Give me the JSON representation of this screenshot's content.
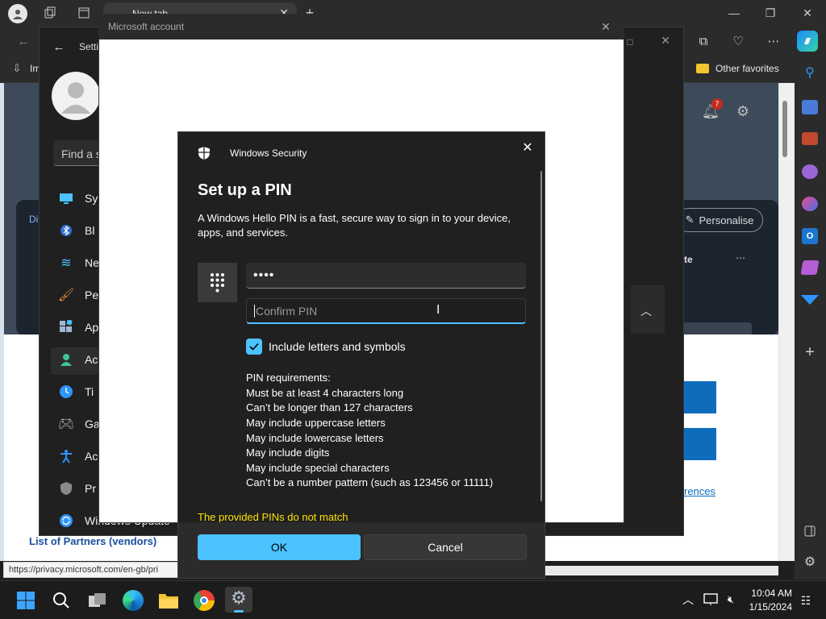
{
  "browser": {
    "tab_title": "New tab",
    "favorites": {
      "left_item": "Im",
      "other_favorites": "Other favorites"
    },
    "status_url": "https://privacy.microsoft.com/en-gb/pri",
    "notification_count": "7",
    "personalise": "Personalise",
    "card_fragment": "te",
    "lower_link": "rences",
    "partners_link": "List of Partners (vendors)",
    "tab_fragment": "Di"
  },
  "settings": {
    "title": "Setti",
    "search_placeholder": "Find a s",
    "nav": [
      {
        "label": "Sy",
        "icon": "system-icon"
      },
      {
        "label": "Bl",
        "icon": "bluetooth-icon"
      },
      {
        "label": "Ne",
        "icon": "network-icon"
      },
      {
        "label": "Pe",
        "icon": "personalisation-icon"
      },
      {
        "label": "Ap",
        "icon": "apps-icon"
      },
      {
        "label": "Ac",
        "icon": "accounts-icon"
      },
      {
        "label": "Ti",
        "icon": "time-icon"
      },
      {
        "label": "Ga",
        "icon": "gaming-icon"
      },
      {
        "label": "Ac",
        "icon": "accessibility-icon"
      },
      {
        "label": "Pr",
        "icon": "privacy-icon"
      },
      {
        "label": "Windows Update",
        "icon": "update-icon"
      }
    ]
  },
  "ms_account": {
    "title": "Microsoft account"
  },
  "winsec": {
    "app_title": "Windows Security",
    "heading": "Set up a PIN",
    "description": "A Windows Hello PIN is a fast, secure way to sign in to your device, apps, and services.",
    "pin_value": "••••",
    "confirm_placeholder": "Confirm PIN",
    "checkbox_label": "Include letters and symbols",
    "requirements_title": "PIN requirements:",
    "requirements": [
      "Must be at least 4 characters long",
      "Can’t be longer than 127 characters",
      "May include uppercase letters",
      "May include lowercase letters",
      "May include digits",
      "May include special characters",
      "Can’t be a number pattern (such as 123456 or 11111)"
    ],
    "error": "The provided PINs do not match",
    "ok_label": "OK",
    "cancel_label": "Cancel"
  },
  "taskbar": {
    "time": "10:04 AM",
    "date": "1/15/2024"
  },
  "colors": {
    "accent": "#4cc2ff",
    "error": "#fce100",
    "blue_button": "#0f6cbd"
  }
}
